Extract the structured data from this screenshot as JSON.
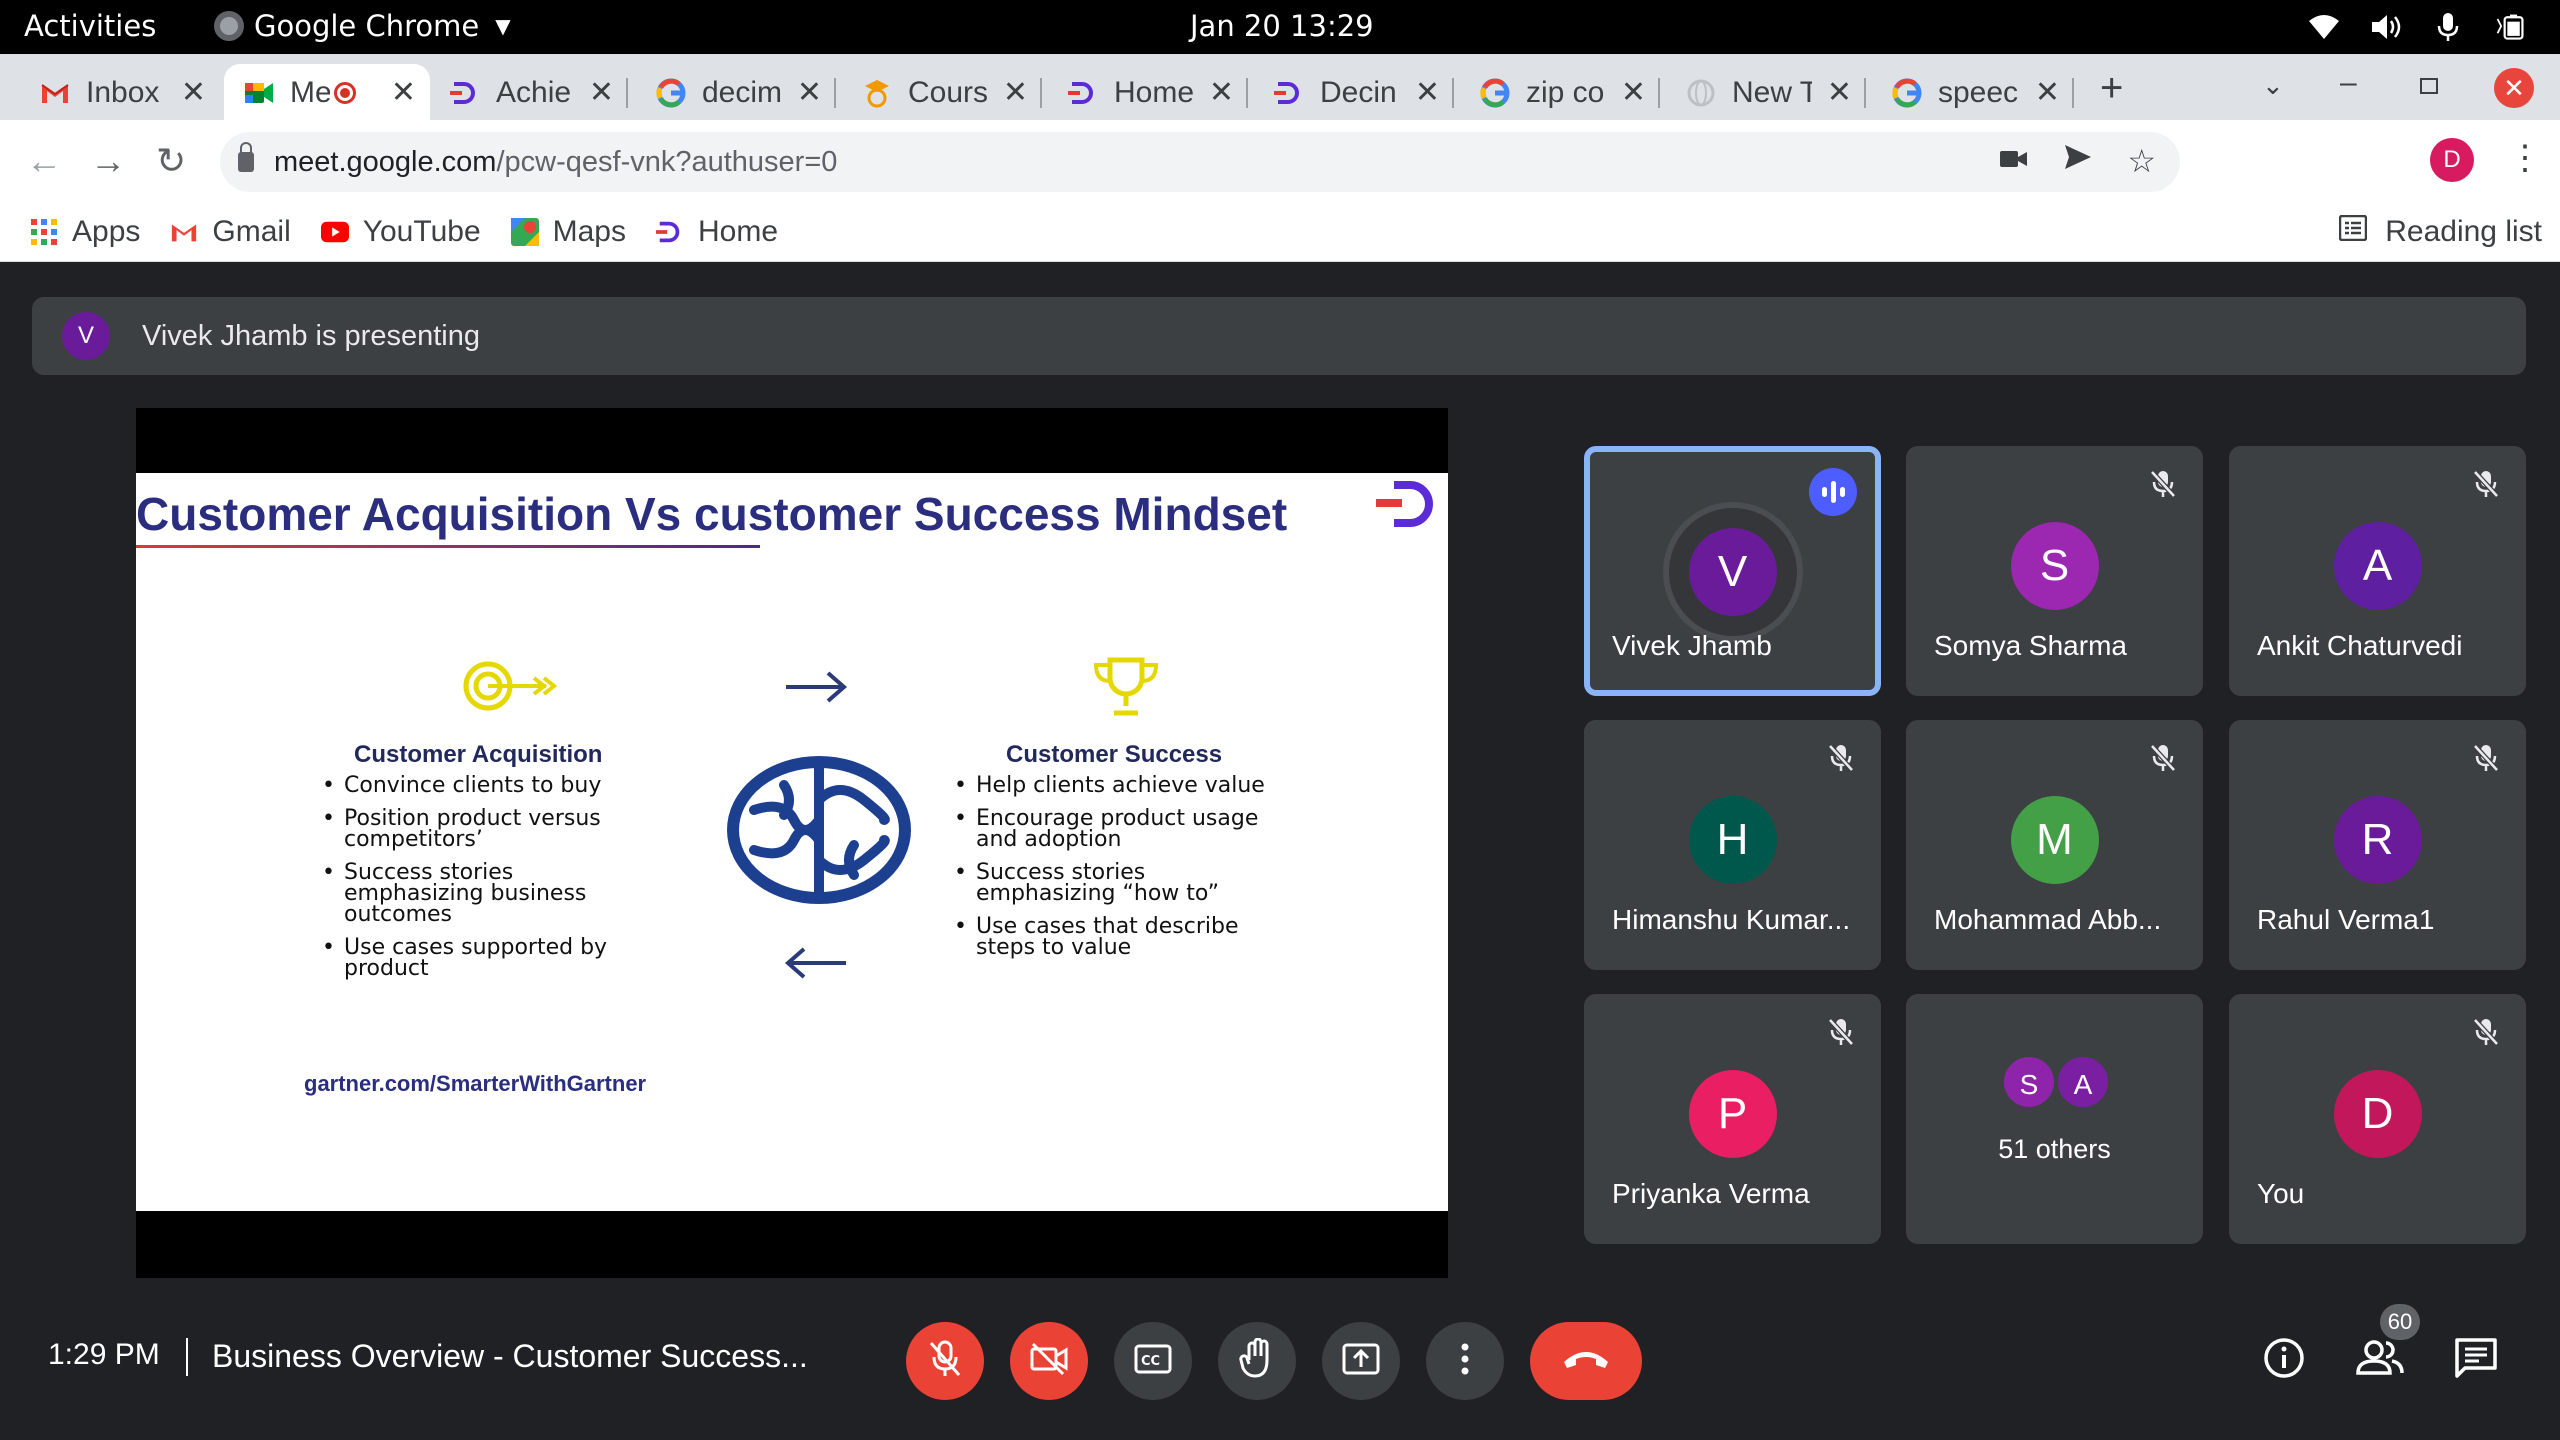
{
  "topbar": {
    "activities": "Activities",
    "app_name": "Google Chrome",
    "clock": "Jan 20  13:29"
  },
  "tabs": [
    {
      "title": "Inbox",
      "icon": "gmail-icon"
    },
    {
      "title": "Me",
      "icon": "meet-icon",
      "active": true
    },
    {
      "title": "Achie",
      "icon": "site-d-icon"
    },
    {
      "title": "decim",
      "icon": "google-icon"
    },
    {
      "title": "Cours",
      "icon": "course-icon"
    },
    {
      "title": "Home",
      "icon": "site-d-icon"
    },
    {
      "title": "Decin",
      "icon": "site-d-icon"
    },
    {
      "title": "zip co",
      "icon": "google-icon"
    },
    {
      "title": "New T",
      "icon": "globe-icon"
    },
    {
      "title": "speec",
      "icon": "google-icon"
    }
  ],
  "address": {
    "domain": "meet.google.com",
    "path": "/pcw-qesf-vnk?authuser=0",
    "profile_initial": "D"
  },
  "bookmarks": [
    {
      "label": "Apps",
      "icon": "apps-grid-icon"
    },
    {
      "label": "Gmail",
      "icon": "gmail-icon"
    },
    {
      "label": "YouTube",
      "icon": "youtube-icon"
    },
    {
      "label": "Maps",
      "icon": "maps-icon"
    },
    {
      "label": "Home",
      "icon": "site-d-icon"
    }
  ],
  "reading_list": "Reading list",
  "presenting": {
    "initial": "V",
    "text": "Vivek Jhamb is presenting"
  },
  "slide": {
    "title": "Customer Acquisition Vs customer Success Mindset",
    "left_heading": "Customer Acquisition",
    "left_bullets": [
      "Convince clients to buy",
      "Position product versus competitors’",
      "Success stories emphasizing business outcomes",
      "Use cases supported by product"
    ],
    "right_heading": "Customer Success",
    "right_bullets": [
      "Help clients achieve value",
      "Encourage product usage and adoption",
      "Success stories emphasizing “how to”",
      "Use cases that describe steps to value"
    ],
    "footer": "gartner.com/SmarterWithGartner"
  },
  "participants": [
    {
      "name": "Vivek Jhamb",
      "initial": "V",
      "color": "#6a1b9a",
      "speaking": true
    },
    {
      "name": "Somya Sharma",
      "initial": "S",
      "color": "#9c27b0",
      "muted": true
    },
    {
      "name": "Ankit Chaturvedi",
      "initial": "A",
      "color": "#5e1fa0",
      "muted": true
    },
    {
      "name": "Himanshu Kumar...",
      "initial": "H",
      "color": "#00574b",
      "muted": true
    },
    {
      "name": "Mohammad Abb...",
      "initial": "M",
      "color": "#43a047",
      "muted": true
    },
    {
      "name": "Rahul Verma1",
      "initial": "R",
      "color": "#6a1b9a",
      "muted": true
    },
    {
      "name": "Priyanka Verma",
      "initial": "P",
      "color": "#e91e63",
      "muted": true
    },
    {
      "name": "You",
      "initial": "D",
      "color": "#c2185b",
      "muted": true
    }
  ],
  "others": {
    "initials": [
      "S",
      "A"
    ],
    "colors": [
      "#8e24aa",
      "#7b1fa2"
    ],
    "text": "51 others"
  },
  "bottom": {
    "time": "1:29 PM",
    "meeting_title": "Business Overview - Customer Success...",
    "people_count": "60"
  }
}
